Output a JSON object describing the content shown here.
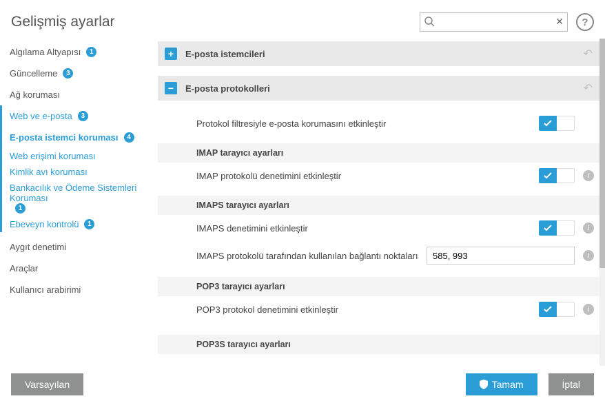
{
  "header": {
    "title": "Gelişmiş ayarlar",
    "search_placeholder": "",
    "help_label": "?"
  },
  "sidebar": [
    {
      "label": "Algılama Altyapısı",
      "badge": "1",
      "style": "plain"
    },
    {
      "label": "Güncelleme",
      "badge": "3",
      "style": "plain"
    },
    {
      "label": "Ağ koruması",
      "badge": "",
      "style": "plain"
    },
    {
      "label": "Web ve e-posta",
      "badge": "3",
      "style": "blue"
    },
    {
      "label": "E-posta istemci koruması",
      "badge": "4",
      "style": "active"
    },
    {
      "label": "Web erişimi koruması",
      "badge": "",
      "style": "link"
    },
    {
      "label": "Kimlik avı koruması",
      "badge": "",
      "style": "link"
    },
    {
      "label": "Bankacılık ve Ödeme Sistemleri Koruması",
      "badge": "1",
      "style": "link"
    },
    {
      "label": "Ebeveyn kontrolü",
      "badge": "1",
      "style": "link"
    },
    {
      "label": "Aygıt denetimi",
      "badge": "",
      "style": "plain"
    },
    {
      "label": "Araçlar",
      "badge": "",
      "style": "plain"
    },
    {
      "label": "Kullanıcı arabirimi",
      "badge": "",
      "style": "plain"
    }
  ],
  "groups": {
    "clients": {
      "title": "E-posta istemcileri",
      "expanded": false
    },
    "protocols": {
      "title": "E-posta protokolleri",
      "expanded": true
    }
  },
  "rows": {
    "protocolFilter": {
      "label": "Protokol filtresiyle e-posta korumasını etkinleştir",
      "on": true,
      "info": false
    },
    "imapHeader": "IMAP tarayıcı ayarları",
    "imapCheck": {
      "label": "IMAP protokolü denetimini etkinleştir",
      "on": true,
      "info": true
    },
    "imapsHeader": "IMAPS tarayıcı ayarları",
    "imapsCheck": {
      "label": "IMAPS denetimini etkinleştir",
      "on": true,
      "info": true
    },
    "imapsPorts": {
      "label": "IMAPS protokolü tarafından kullanılan bağlantı noktaları",
      "value": "585, 993",
      "info": true
    },
    "pop3Header": "POP3 tarayıcı ayarları",
    "pop3Check": {
      "label": "POP3 protokol denetimini etkinleştir",
      "on": true,
      "info": true
    },
    "pop3sHeader": "POP3S tarayıcı ayarları"
  },
  "footer": {
    "default_label": "Varsayılan",
    "ok_label": "Tamam",
    "cancel_label": "İptal"
  }
}
